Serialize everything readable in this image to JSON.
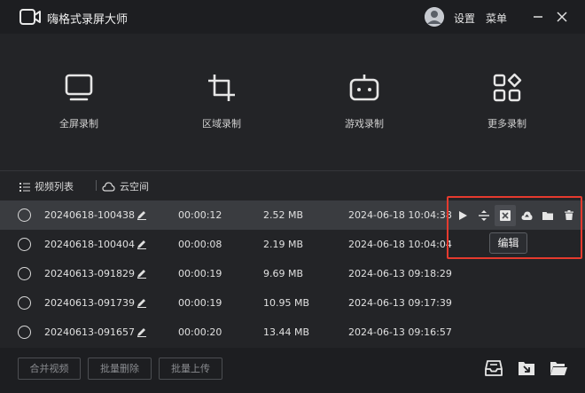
{
  "app": {
    "title": "嗨格式录屏大师"
  },
  "titlebar": {
    "settings_label": "设置",
    "menu_label": "菜单"
  },
  "modes": [
    {
      "label": "全屏录制",
      "icon": "monitor-icon"
    },
    {
      "label": "区域录制",
      "icon": "crop-icon"
    },
    {
      "label": "游戏录制",
      "icon": "gamepad-icon"
    },
    {
      "label": "更多录制",
      "icon": "grid-apps-icon"
    }
  ],
  "tabs": {
    "video_list": "视频列表",
    "cloud_space": "云空间"
  },
  "videos": [
    {
      "name": "20240618-100438",
      "duration": "00:00:12",
      "size": "2.52 MB",
      "date": "2024-06-18 10:04:38"
    },
    {
      "name": "20240618-100404",
      "duration": "00:00:08",
      "size": "2.19 MB",
      "date": "2024-06-18 10:04:04"
    },
    {
      "name": "20240613-091829",
      "duration": "00:00:19",
      "size": "9.69 MB",
      "date": "2024-06-13 09:18:29"
    },
    {
      "name": "20240613-091739",
      "duration": "00:00:19",
      "size": "10.95 MB",
      "date": "2024-06-13 09:17:39"
    },
    {
      "name": "20240613-091657",
      "duration": "00:00:20",
      "size": "13.44 MB",
      "date": "2024-06-13 09:16:57"
    }
  ],
  "row_actions": [
    "play-icon",
    "split-icon",
    "edit-icon",
    "cloud-upload-icon",
    "folder-icon",
    "trash-icon"
  ],
  "tooltip": {
    "text": "编辑"
  },
  "footer": {
    "merge_label": "合并视频",
    "batch_delete_label": "批量删除",
    "batch_upload_label": "批量上传"
  },
  "colors": {
    "background": "#232427",
    "titlebar": "#1d1e21",
    "selected_row": "#3a3c40",
    "highlight": "#e53a2e"
  }
}
